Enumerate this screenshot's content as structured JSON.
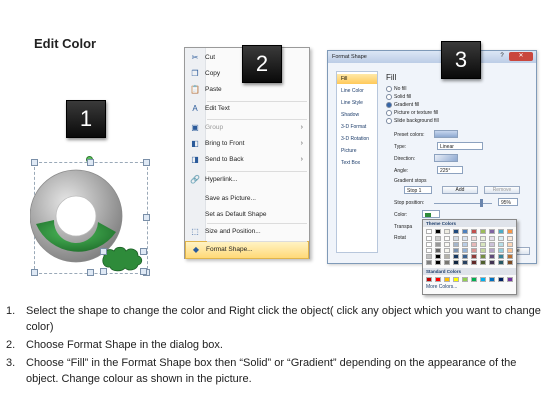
{
  "title": "Edit Color",
  "badges": [
    "1",
    "2",
    "3"
  ],
  "context_menu": {
    "items": [
      {
        "label": "Cut",
        "icon": "scissors-icon",
        "glyph": "✂",
        "disabled": false,
        "submenu": false
      },
      {
        "label": "Copy",
        "icon": "copy-icon",
        "glyph": "❐",
        "disabled": false,
        "submenu": false
      },
      {
        "label": "Paste",
        "icon": "paste-icon",
        "glyph": "📋",
        "disabled": false,
        "submenu": false
      },
      {
        "label": "Edit Text",
        "icon": "edit-text-icon",
        "glyph": "A",
        "disabled": false,
        "submenu": false
      },
      {
        "label": "Group",
        "icon": "group-icon",
        "glyph": "▣",
        "disabled": true,
        "submenu": true
      },
      {
        "label": "Bring to Front",
        "icon": "bring-front-icon",
        "glyph": "◧",
        "disabled": false,
        "submenu": true
      },
      {
        "label": "Send to Back",
        "icon": "send-back-icon",
        "glyph": "◨",
        "disabled": false,
        "submenu": true
      },
      {
        "label": "Hyperlink...",
        "icon": "hyperlink-icon",
        "glyph": "🔗",
        "disabled": false,
        "submenu": false
      },
      {
        "label": "Save as Picture...",
        "icon": "",
        "glyph": "",
        "disabled": false,
        "submenu": false
      },
      {
        "label": "Set as Default Shape",
        "icon": "",
        "glyph": "",
        "disabled": false,
        "submenu": false
      },
      {
        "label": "Size and Position...",
        "icon": "size-position-icon",
        "glyph": "⬚",
        "disabled": false,
        "submenu": false
      },
      {
        "label": "Format Shape...",
        "icon": "format-shape-icon",
        "glyph": "◆",
        "disabled": false,
        "submenu": false,
        "highlighted": true
      }
    ]
  },
  "dialog": {
    "title": "Format Shape",
    "nav": [
      "Fill",
      "Line Color",
      "Line Style",
      "Shadow",
      "3-D Format",
      "3-D Rotation",
      "Picture",
      "Text Box"
    ],
    "selected_nav": "Fill",
    "heading": "Fill",
    "options": [
      "No fill",
      "Solid fill",
      "Gradient fill",
      "Picture or texture fill",
      "Slide background fill"
    ],
    "selected_option": "Gradient fill",
    "preset_label": "Preset colors:",
    "type_label": "Type:",
    "type_value": "Linear",
    "direction_label": "Direction:",
    "angle_label": "Angle:",
    "angle_value": "225°",
    "gradient_stops_label": "Gradient stops",
    "stop_value": "Stop 1",
    "add_button": "Add",
    "remove_button": "Remove",
    "stop_position_label": "Stop position:",
    "stop_position_value": "95%",
    "color_label": "Color:",
    "transparency_label": "Transpa",
    "rotate_label": "Rotat",
    "close_fragment": "se"
  },
  "palette": {
    "theme_label": "Theme Colors",
    "standard_label": "Standard Colors",
    "more_label": "More Colors...",
    "theme_top": [
      "#ffffff",
      "#000000",
      "#eeece1",
      "#1f497d",
      "#4f81bd",
      "#c0504d",
      "#9bbb59",
      "#8064a2",
      "#4bacc6",
      "#f79646"
    ],
    "standard": [
      "#c00000",
      "#ff0000",
      "#ffc000",
      "#ffff00",
      "#92d050",
      "#00b050",
      "#00b0f0",
      "#0070c0",
      "#002060",
      "#7030a0"
    ]
  },
  "colors": {
    "shape_green": "#2e8b3a",
    "shape_gray": "#9a9a9a",
    "highlight": "#ffd978"
  },
  "instructions": [
    {
      "n": "1.",
      "text": "Select the shape to change the color and Right click the object( click any object which you want to change color)"
    },
    {
      "n": "2.",
      "text": "Choose Format Shape in the dialog box."
    },
    {
      "n": "3.",
      "text": "Choose “Fill” in the Format Shape box then “Solid” or “Gradient” depending on the appearance of the object. Change colour as shown in the picture."
    }
  ]
}
